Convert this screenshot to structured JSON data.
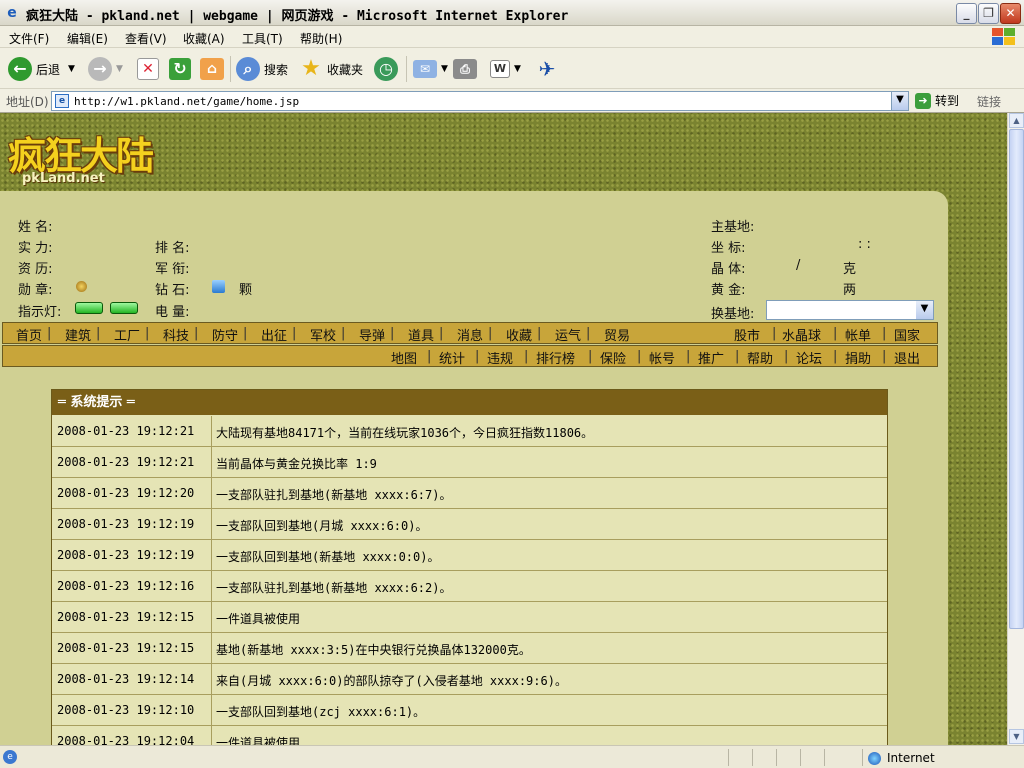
{
  "window": {
    "title": "疯狂大陆 - pkland.net | webgame | 网页游戏 - Microsoft Internet Explorer",
    "min_glyph": "_",
    "max_glyph": "❐",
    "close_glyph": "✕"
  },
  "menu": [
    "文件(F)",
    "编辑(E)",
    "查看(V)",
    "收藏(A)",
    "工具(T)",
    "帮助(H)"
  ],
  "toolbar": {
    "back_label": "后退",
    "search_label": "搜索",
    "favorites_label": "收藏夹"
  },
  "address": {
    "label": "地址(D)",
    "url": "http://w1.pkland.net/game/home.jsp",
    "go_label": "转到",
    "links_label": "链接"
  },
  "logo": {
    "title": "疯狂大陆",
    "subtitle": "pkLand.net"
  },
  "profile": {
    "name_label": "姓  名:",
    "power_label": "实  力:",
    "rank_label": "排  名:",
    "exp_label": "资  历:",
    "title_label": "军  衔:",
    "medal_label": "勋  章:",
    "diamond_label": "钻  石:",
    "diamond_unit": "颗",
    "indicator_label": "指示灯:",
    "power2_label": "电  量:",
    "main_base_label": "主基地:",
    "coord_label": "坐  标:",
    "coord_value": ": :",
    "crystal_label": "晶  体:",
    "crystal_value": "/",
    "crystal_unit": "克",
    "gold_label": "黄  金:",
    "gold_unit": "两",
    "switch_base_label": "换基地:"
  },
  "nav_primary_left": [
    "首页",
    "建筑",
    "工厂",
    "科技",
    "防守",
    "出征",
    "军校",
    "导弹",
    "道具",
    "消息",
    "收藏",
    "运气",
    "贸易"
  ],
  "nav_primary_right": [
    "股市",
    "水晶球",
    "帐单",
    "国家"
  ],
  "nav_secondary": [
    "地图",
    "统计",
    "违规",
    "排行榜",
    "保险",
    "帐号",
    "推广",
    "帮助",
    "论坛",
    "捐助",
    "退出"
  ],
  "system": {
    "header": "═ 系统提示 ═",
    "rows": [
      {
        "time": "2008-01-23 19:12:21",
        "msg": "大陆现有基地84171个，当前在线玩家1036个，今日疯狂指数11806。"
      },
      {
        "time": "2008-01-23 19:12:21",
        "msg": "当前晶体与黄金兑换比率 1:9"
      },
      {
        "time": "2008-01-23 19:12:20",
        "msg": "一支部队驻扎到基地(新基地 xxxx:6:7)。"
      },
      {
        "time": "2008-01-23 19:12:19",
        "msg": "一支部队回到基地(月城 xxxx:6:0)。"
      },
      {
        "time": "2008-01-23 19:12:19",
        "msg": "一支部队回到基地(新基地 xxxx:0:0)。"
      },
      {
        "time": "2008-01-23 19:12:16",
        "msg": "一支部队驻扎到基地(新基地 xxxx:6:2)。"
      },
      {
        "time": "2008-01-23 19:12:15",
        "msg": "一件道具被使用"
      },
      {
        "time": "2008-01-23 19:12:15",
        "msg": "基地(新基地 xxxx:3:5)在中央银行兑换晶体132000克。"
      },
      {
        "time": "2008-01-23 19:12:14",
        "msg": "来自(月城 xxxx:6:0)的部队掠夺了(入侵者基地 xxxx:9:6)。"
      },
      {
        "time": "2008-01-23 19:12:10",
        "msg": "一支部队回到基地(zcj xxxx:6:1)。"
      },
      {
        "time": "2008-01-23 19:12:04",
        "msg": "一件道具被使用"
      }
    ]
  },
  "status": {
    "zone": "Internet"
  }
}
